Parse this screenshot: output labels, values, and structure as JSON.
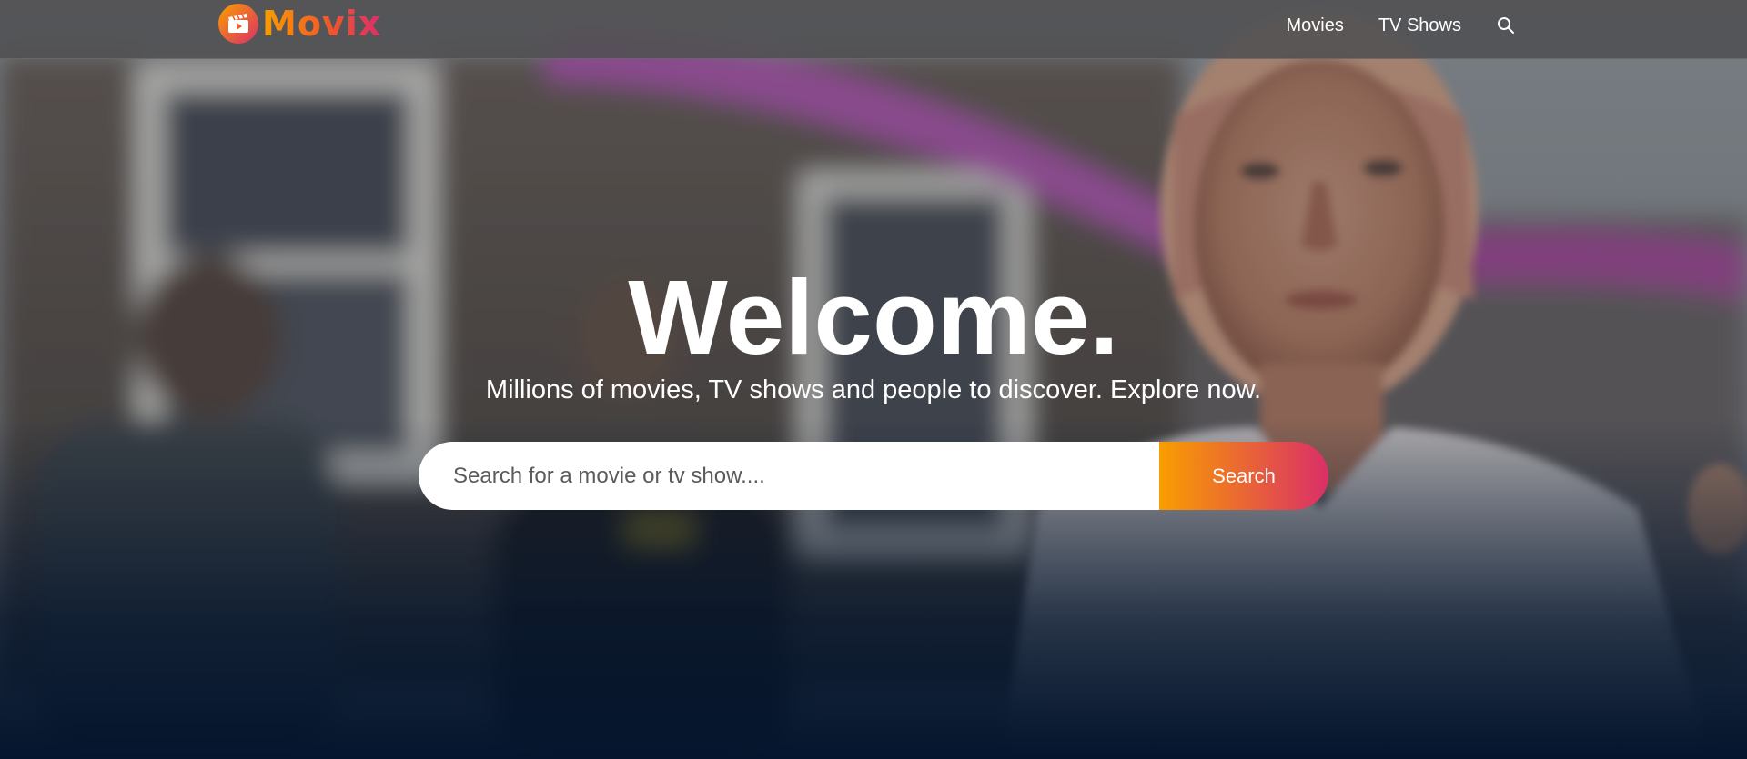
{
  "header": {
    "logo_text": "Movix",
    "logo_icon": "clapperboard-play-icon",
    "nav": {
      "movies_label": "Movies",
      "tv_shows_label": "TV Shows",
      "search_icon": "search-icon"
    }
  },
  "hero": {
    "title": "Welcome.",
    "subtitle": "Millions of movies, TV shows and people to discover. Explore now.",
    "search": {
      "placeholder": "Search for a movie or tv show....",
      "value": "",
      "button_label": "Search"
    }
  },
  "colors": {
    "brand_orange": "#f89e00",
    "brand_pink": "#da2f68",
    "background": "#04152d",
    "header_bg": "#505052"
  }
}
